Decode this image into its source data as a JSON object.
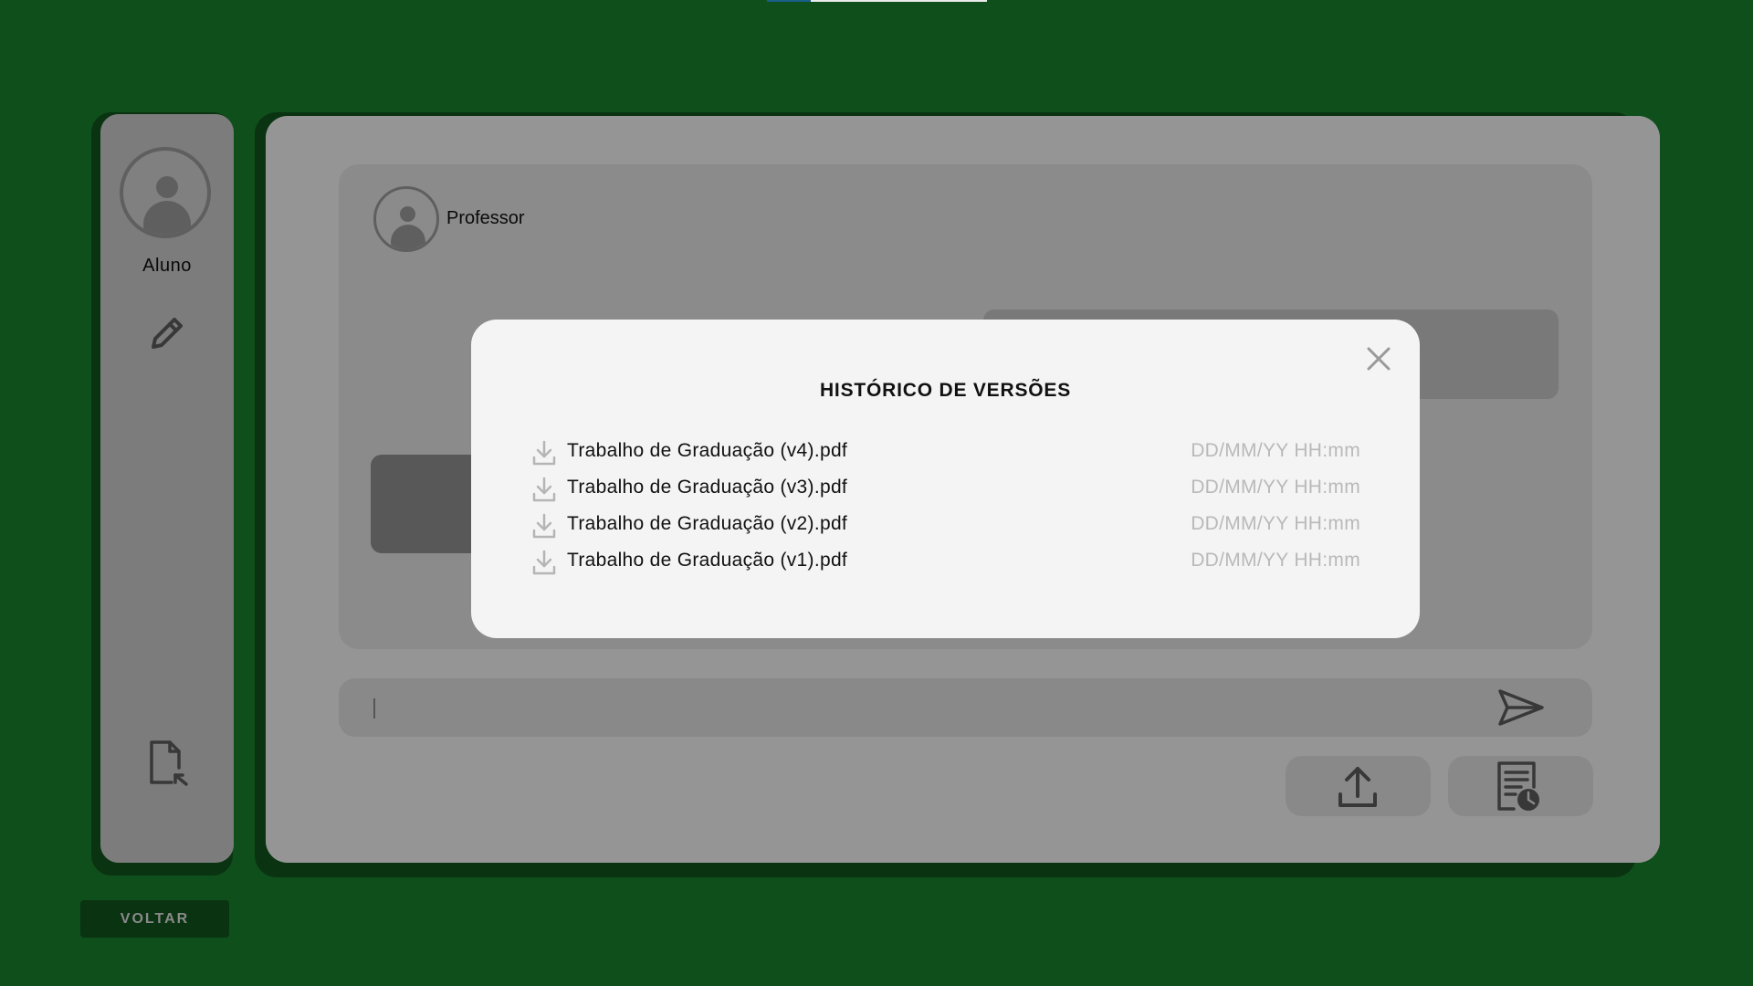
{
  "sidebar": {
    "student_name": "Aluno",
    "icons": {
      "avatar": "user-avatar",
      "edit": "pencil-icon",
      "document": "document-export-icon"
    }
  },
  "chat": {
    "professor_name": "Professor",
    "input": {
      "value": ""
    },
    "icons": {
      "send": "send-icon",
      "upload": "upload-icon",
      "history": "document-history-icon"
    }
  },
  "back_button": {
    "label": "VOLTAR"
  },
  "modal": {
    "title": "HISTÓRICO DE VERSÕES",
    "close_icon": "close-icon",
    "versions": [
      {
        "file": "Trabalho de Graduação (v4).pdf",
        "date": "DD/MM/YY HH:mm"
      },
      {
        "file": "Trabalho de Graduação (v3).pdf",
        "date": "DD/MM/YY HH:mm"
      },
      {
        "file": "Trabalho de Graduação (v2).pdf",
        "date": "DD/MM/YY HH:mm"
      },
      {
        "file": "Trabalho de Graduação (v1).pdf",
        "date": "DD/MM/YY HH:mm"
      }
    ]
  },
  "colors": {
    "background": "#0f4f1b",
    "panel": "#f1f1f1",
    "panel_shadow": "#0a3312",
    "modal": "#f4f4f4",
    "muted_text": "#b9b9b9"
  }
}
